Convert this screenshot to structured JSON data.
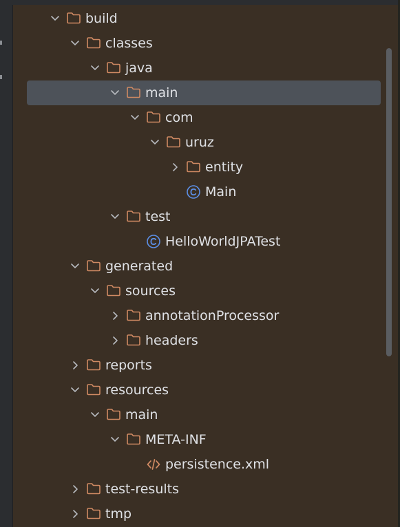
{
  "tree": [
    {
      "label": "build",
      "depth": 0,
      "type": "folder",
      "expanded": true
    },
    {
      "label": "classes",
      "depth": 1,
      "type": "folder",
      "expanded": true
    },
    {
      "label": "java",
      "depth": 2,
      "type": "folder",
      "expanded": true
    },
    {
      "label": "main",
      "depth": 3,
      "type": "folder",
      "expanded": true,
      "selected": true
    },
    {
      "label": "com",
      "depth": 4,
      "type": "folder",
      "expanded": true
    },
    {
      "label": "uruz",
      "depth": 5,
      "type": "folder",
      "expanded": true
    },
    {
      "label": "entity",
      "depth": 6,
      "type": "folder",
      "expanded": false
    },
    {
      "label": "Main",
      "depth": 6,
      "type": "class"
    },
    {
      "label": "test",
      "depth": 3,
      "type": "folder",
      "expanded": true
    },
    {
      "label": "HelloWorldJPATest",
      "depth": 4,
      "type": "class"
    },
    {
      "label": "generated",
      "depth": 1,
      "type": "folder",
      "expanded": true
    },
    {
      "label": "sources",
      "depth": 2,
      "type": "folder",
      "expanded": true
    },
    {
      "label": "annotationProcessor",
      "depth": 3,
      "type": "folder",
      "expanded": false
    },
    {
      "label": "headers",
      "depth": 3,
      "type": "folder",
      "expanded": false
    },
    {
      "label": "reports",
      "depth": 1,
      "type": "folder",
      "expanded": false
    },
    {
      "label": "resources",
      "depth": 1,
      "type": "folder",
      "expanded": true
    },
    {
      "label": "main",
      "depth": 2,
      "type": "folder",
      "expanded": true
    },
    {
      "label": "META-INF",
      "depth": 3,
      "type": "folder",
      "expanded": true
    },
    {
      "label": "persistence.xml",
      "depth": 4,
      "type": "xml"
    },
    {
      "label": "test-results",
      "depth": 1,
      "type": "folder",
      "expanded": false
    },
    {
      "label": "tmp",
      "depth": 1,
      "type": "folder",
      "expanded": false
    }
  ],
  "colors": {
    "background": "#3a2f24",
    "folder": "#d08a63",
    "class_icon": "#5c8fe6",
    "xml_icon": "#d08a63",
    "text": "#dfe1e5",
    "chevron": "#b6b9be",
    "selection": "#4d5259"
  }
}
